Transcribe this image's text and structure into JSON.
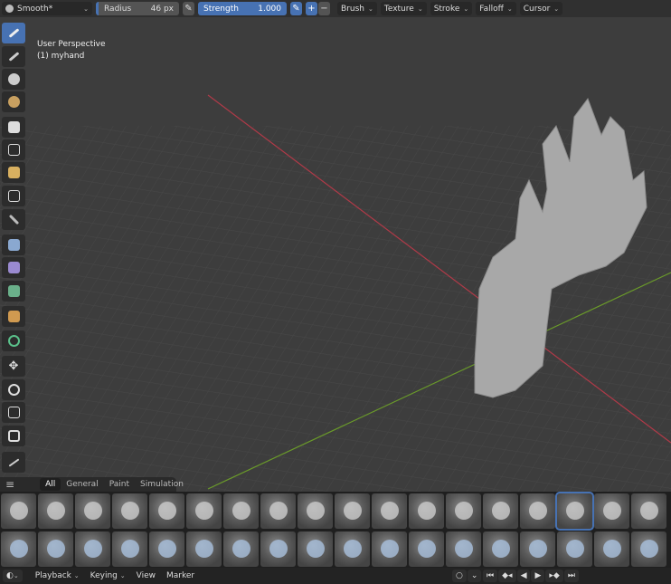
{
  "header": {
    "brush_name": "Smooth*",
    "radius_label": "Radius",
    "radius_value": "46 px",
    "strength_label": "Strength",
    "strength_value": "1.000",
    "plus": "+",
    "minus": "−",
    "menus": [
      "Brush",
      "Texture",
      "Stroke",
      "Falloff",
      "Cursor"
    ]
  },
  "viewport": {
    "view_name": "User Perspective",
    "object_name": "(1) myhand"
  },
  "toolbar": {
    "tools": [
      "draw-brush",
      "smooth",
      "grab",
      "snake-hook",
      "mask",
      "box-mask",
      "lasso-mask",
      "face-set",
      "line-project",
      "box-trim",
      "lasso-trim",
      "box-face-set",
      "mesh-filter",
      "cloth-filter",
      "move",
      "rotate",
      "scale",
      "transform",
      "annotate"
    ],
    "active_index": 0
  },
  "asset_shelf": {
    "tabs": [
      "All",
      "General",
      "Paint",
      "Simulation"
    ],
    "active_tab": "All",
    "selected_brush_index": 15,
    "brush_count": 36
  },
  "timeline": {
    "menus": [
      "Playback",
      "Keying",
      "View",
      "Marker"
    ],
    "controls": [
      "jump-start",
      "prev-keyframe",
      "play-reverse",
      "play",
      "next-keyframe",
      "jump-end"
    ]
  },
  "colors": {
    "accent": "#4772b3",
    "x_axis": "#c0394a",
    "y_axis": "#6a9a2a",
    "viewport_bg": "#3d3d3d"
  }
}
